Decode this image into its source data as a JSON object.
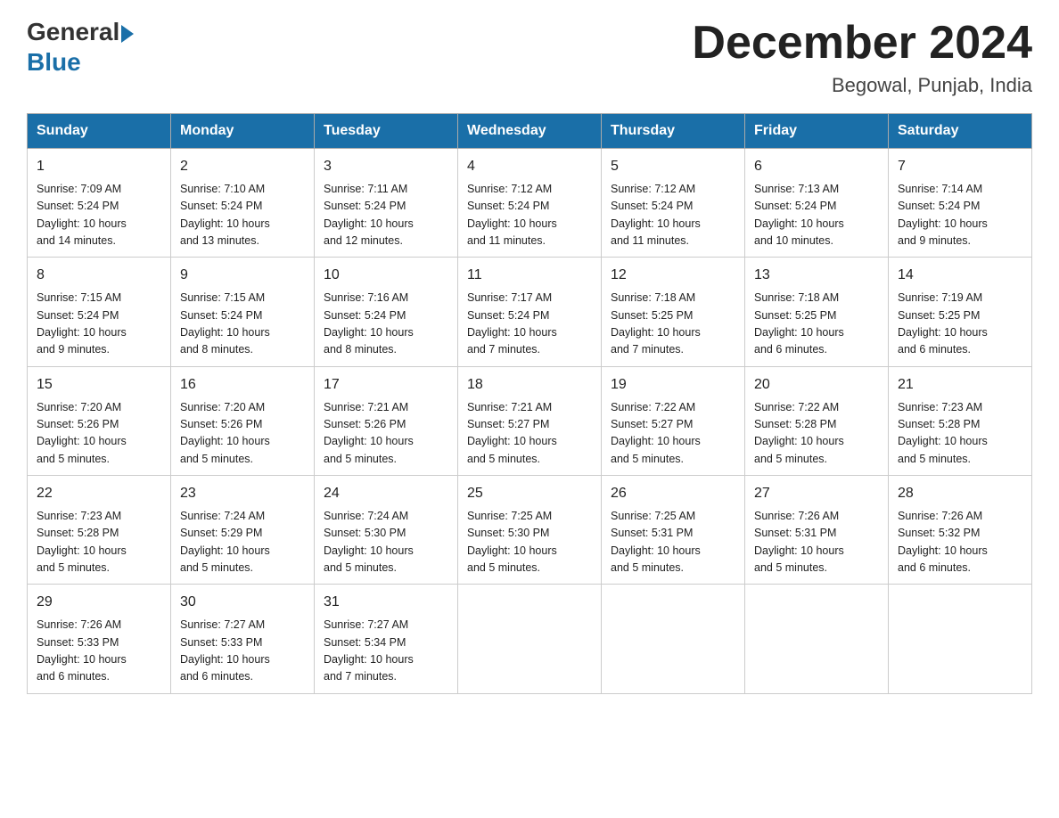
{
  "header": {
    "logo_general": "General",
    "logo_blue": "Blue",
    "month_title": "December 2024",
    "location": "Begowal, Punjab, India"
  },
  "weekdays": [
    "Sunday",
    "Monday",
    "Tuesday",
    "Wednesday",
    "Thursday",
    "Friday",
    "Saturday"
  ],
  "weeks": [
    [
      {
        "day": "1",
        "sunrise": "7:09 AM",
        "sunset": "5:24 PM",
        "daylight": "10 hours and 14 minutes."
      },
      {
        "day": "2",
        "sunrise": "7:10 AM",
        "sunset": "5:24 PM",
        "daylight": "10 hours and 13 minutes."
      },
      {
        "day": "3",
        "sunrise": "7:11 AM",
        "sunset": "5:24 PM",
        "daylight": "10 hours and 12 minutes."
      },
      {
        "day": "4",
        "sunrise": "7:12 AM",
        "sunset": "5:24 PM",
        "daylight": "10 hours and 11 minutes."
      },
      {
        "day": "5",
        "sunrise": "7:12 AM",
        "sunset": "5:24 PM",
        "daylight": "10 hours and 11 minutes."
      },
      {
        "day": "6",
        "sunrise": "7:13 AM",
        "sunset": "5:24 PM",
        "daylight": "10 hours and 10 minutes."
      },
      {
        "day": "7",
        "sunrise": "7:14 AM",
        "sunset": "5:24 PM",
        "daylight": "10 hours and 9 minutes."
      }
    ],
    [
      {
        "day": "8",
        "sunrise": "7:15 AM",
        "sunset": "5:24 PM",
        "daylight": "10 hours and 9 minutes."
      },
      {
        "day": "9",
        "sunrise": "7:15 AM",
        "sunset": "5:24 PM",
        "daylight": "10 hours and 8 minutes."
      },
      {
        "day": "10",
        "sunrise": "7:16 AM",
        "sunset": "5:24 PM",
        "daylight": "10 hours and 8 minutes."
      },
      {
        "day": "11",
        "sunrise": "7:17 AM",
        "sunset": "5:24 PM",
        "daylight": "10 hours and 7 minutes."
      },
      {
        "day": "12",
        "sunrise": "7:18 AM",
        "sunset": "5:25 PM",
        "daylight": "10 hours and 7 minutes."
      },
      {
        "day": "13",
        "sunrise": "7:18 AM",
        "sunset": "5:25 PM",
        "daylight": "10 hours and 6 minutes."
      },
      {
        "day": "14",
        "sunrise": "7:19 AM",
        "sunset": "5:25 PM",
        "daylight": "10 hours and 6 minutes."
      }
    ],
    [
      {
        "day": "15",
        "sunrise": "7:20 AM",
        "sunset": "5:26 PM",
        "daylight": "10 hours and 5 minutes."
      },
      {
        "day": "16",
        "sunrise": "7:20 AM",
        "sunset": "5:26 PM",
        "daylight": "10 hours and 5 minutes."
      },
      {
        "day": "17",
        "sunrise": "7:21 AM",
        "sunset": "5:26 PM",
        "daylight": "10 hours and 5 minutes."
      },
      {
        "day": "18",
        "sunrise": "7:21 AM",
        "sunset": "5:27 PM",
        "daylight": "10 hours and 5 minutes."
      },
      {
        "day": "19",
        "sunrise": "7:22 AM",
        "sunset": "5:27 PM",
        "daylight": "10 hours and 5 minutes."
      },
      {
        "day": "20",
        "sunrise": "7:22 AM",
        "sunset": "5:28 PM",
        "daylight": "10 hours and 5 minutes."
      },
      {
        "day": "21",
        "sunrise": "7:23 AM",
        "sunset": "5:28 PM",
        "daylight": "10 hours and 5 minutes."
      }
    ],
    [
      {
        "day": "22",
        "sunrise": "7:23 AM",
        "sunset": "5:28 PM",
        "daylight": "10 hours and 5 minutes."
      },
      {
        "day": "23",
        "sunrise": "7:24 AM",
        "sunset": "5:29 PM",
        "daylight": "10 hours and 5 minutes."
      },
      {
        "day": "24",
        "sunrise": "7:24 AM",
        "sunset": "5:30 PM",
        "daylight": "10 hours and 5 minutes."
      },
      {
        "day": "25",
        "sunrise": "7:25 AM",
        "sunset": "5:30 PM",
        "daylight": "10 hours and 5 minutes."
      },
      {
        "day": "26",
        "sunrise": "7:25 AM",
        "sunset": "5:31 PM",
        "daylight": "10 hours and 5 minutes."
      },
      {
        "day": "27",
        "sunrise": "7:26 AM",
        "sunset": "5:31 PM",
        "daylight": "10 hours and 5 minutes."
      },
      {
        "day": "28",
        "sunrise": "7:26 AM",
        "sunset": "5:32 PM",
        "daylight": "10 hours and 6 minutes."
      }
    ],
    [
      {
        "day": "29",
        "sunrise": "7:26 AM",
        "sunset": "5:33 PM",
        "daylight": "10 hours and 6 minutes."
      },
      {
        "day": "30",
        "sunrise": "7:27 AM",
        "sunset": "5:33 PM",
        "daylight": "10 hours and 6 minutes."
      },
      {
        "day": "31",
        "sunrise": "7:27 AM",
        "sunset": "5:34 PM",
        "daylight": "10 hours and 7 minutes."
      },
      null,
      null,
      null,
      null
    ]
  ],
  "labels": {
    "sunrise": "Sunrise:",
    "sunset": "Sunset:",
    "daylight": "Daylight:"
  }
}
